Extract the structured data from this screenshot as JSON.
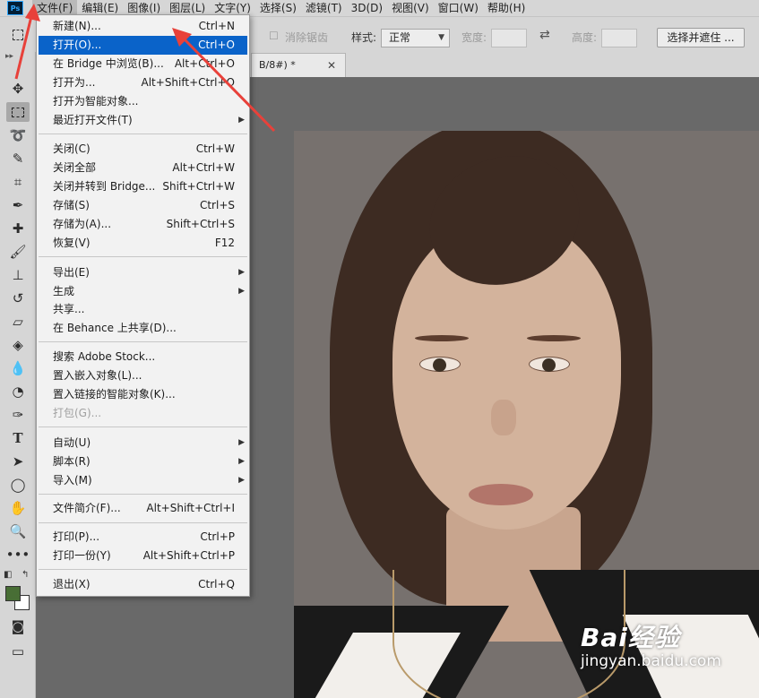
{
  "app": {
    "logo": "Ps",
    "menubar": [
      "文件(F)",
      "编辑(E)",
      "图像(I)",
      "图层(L)",
      "文字(Y)",
      "选择(S)",
      "滤镜(T)",
      "3D(D)",
      "视图(V)",
      "窗口(W)",
      "帮助(H)"
    ]
  },
  "options": {
    "antialias": "消除锯齿",
    "style_label": "样式:",
    "style_value": "正常",
    "width_label": "宽度:",
    "height_label": "高度:",
    "select_mask_button": "选择并遮住 ..."
  },
  "document_tab": {
    "title": "B/8#) *",
    "close": "✕"
  },
  "file_menu": {
    "items": [
      {
        "label": "新建(N)...",
        "shortcut": "Ctrl+N"
      },
      {
        "label": "打开(O)...",
        "shortcut": "Ctrl+O"
      },
      {
        "label": "在 Bridge 中浏览(B)...",
        "shortcut": "Alt+Ctrl+O"
      },
      {
        "label": "打开为...",
        "shortcut": "Alt+Shift+Ctrl+O"
      },
      {
        "label": "打开为智能对象...",
        "shortcut": ""
      },
      {
        "label": "最近打开文件(T)",
        "shortcut": ""
      },
      {
        "label": "关闭(C)",
        "shortcut": "Ctrl+W"
      },
      {
        "label": "关闭全部",
        "shortcut": "Alt+Ctrl+W"
      },
      {
        "label": "关闭并转到 Bridge...",
        "shortcut": "Shift+Ctrl+W"
      },
      {
        "label": "存储(S)",
        "shortcut": "Ctrl+S"
      },
      {
        "label": "存储为(A)...",
        "shortcut": "Shift+Ctrl+S"
      },
      {
        "label": "恢复(V)",
        "shortcut": "F12"
      },
      {
        "label": "导出(E)",
        "shortcut": ""
      },
      {
        "label": "生成",
        "shortcut": ""
      },
      {
        "label": "共享...",
        "shortcut": ""
      },
      {
        "label": "在 Behance 上共享(D)...",
        "shortcut": ""
      },
      {
        "label": "搜索 Adobe Stock...",
        "shortcut": ""
      },
      {
        "label": "置入嵌入对象(L)...",
        "shortcut": ""
      },
      {
        "label": "置入链接的智能对象(K)...",
        "shortcut": ""
      },
      {
        "label": "打包(G)...",
        "shortcut": ""
      },
      {
        "label": "自动(U)",
        "shortcut": ""
      },
      {
        "label": "脚本(R)",
        "shortcut": ""
      },
      {
        "label": "导入(M)",
        "shortcut": ""
      },
      {
        "label": "文件简介(F)...",
        "shortcut": "Alt+Shift+Ctrl+I"
      },
      {
        "label": "打印(P)...",
        "shortcut": "Ctrl+P"
      },
      {
        "label": "打印一份(Y)",
        "shortcut": "Alt+Shift+Ctrl+P"
      },
      {
        "label": "退出(X)",
        "shortcut": "Ctrl+Q"
      }
    ]
  },
  "watermark": {
    "brand": "Bai经验",
    "url": "jingyan.baidu.com"
  },
  "colors": {
    "highlight": "#0a63c9",
    "foreground_swatch": "#486e35",
    "background_swatch": "#ffffff",
    "arrow": "#e8413a"
  }
}
